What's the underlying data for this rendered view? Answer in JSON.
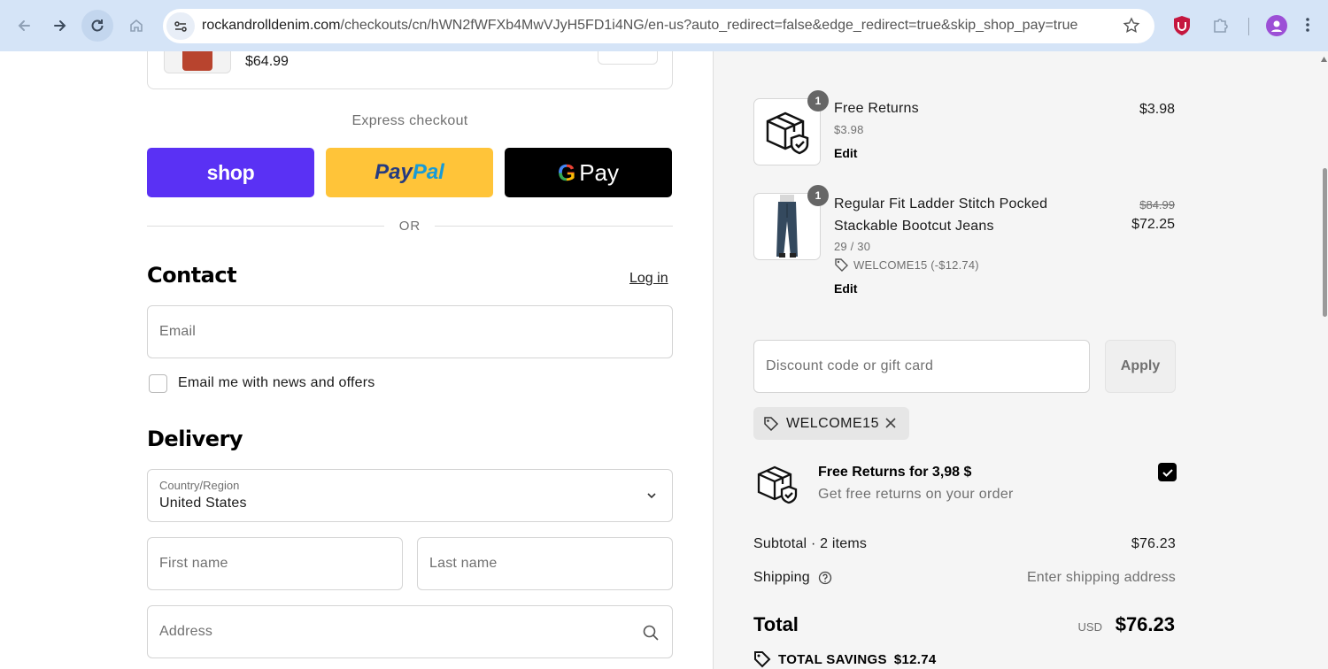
{
  "browser": {
    "url_host": "rockandrolldenim.com",
    "url_path": "/checkouts/cn/hWN2fWFXb4MwVJyH5FD1i4NG/en-us?auto_redirect=false&edge_redirect=true&skip_shop_pay=true"
  },
  "checkout": {
    "top_item_price": "$64.99",
    "express_title": "Express checkout",
    "pay_shop": "shop",
    "pay_paypal_1": "Pay",
    "pay_paypal_2": "Pal",
    "pay_gpay_g": "G",
    "pay_gpay_text": "Pay",
    "or_text": "OR",
    "contact_heading": "Contact",
    "login_link": "Log in",
    "email_placeholder": "Email",
    "newsletter_label": "Email me with news and offers",
    "newsletter_checked": false,
    "delivery_heading": "Delivery",
    "country_label": "Country/Region",
    "country_value": "United States",
    "first_name_placeholder": "First name",
    "last_name_placeholder": "Last name",
    "address_placeholder": "Address"
  },
  "summary": {
    "items": [
      {
        "quantity": "1",
        "name_line1": "Free Returns",
        "variant": "$3.98",
        "edit": "Edit",
        "price": "$3.98"
      },
      {
        "quantity": "1",
        "name_line1": "Regular Fit Ladder Stitch Pocked",
        "name_line2": "Stackable Bootcut Jeans",
        "variant": "29 / 30",
        "discount": "WELCOME15 (-$12.74)",
        "edit": "Edit",
        "old_price": "$84.99",
        "price": "$72.25"
      }
    ],
    "discount_placeholder": "Discount code or gift card",
    "apply_label": "Apply",
    "applied_code": "WELCOME15",
    "free_returns_title": "Free Returns for 3,98 $",
    "free_returns_desc": "Get free returns on your order",
    "free_returns_checked": true,
    "subtotal_label": "Subtotal · 2 items",
    "subtotal_value": "$76.23",
    "shipping_label": "Shipping",
    "shipping_value": "Enter shipping address",
    "total_label": "Total",
    "total_currency": "USD",
    "total_value": "$76.23",
    "savings_label": "TOTAL SAVINGS",
    "savings_value": "$12.74"
  },
  "colors": {
    "shop_pay": "#5a31f4",
    "paypal": "#ffc439",
    "gpay": "#000000",
    "chrome_bar": "#d5e4f7",
    "summary_bg": "#f5f5f5"
  }
}
